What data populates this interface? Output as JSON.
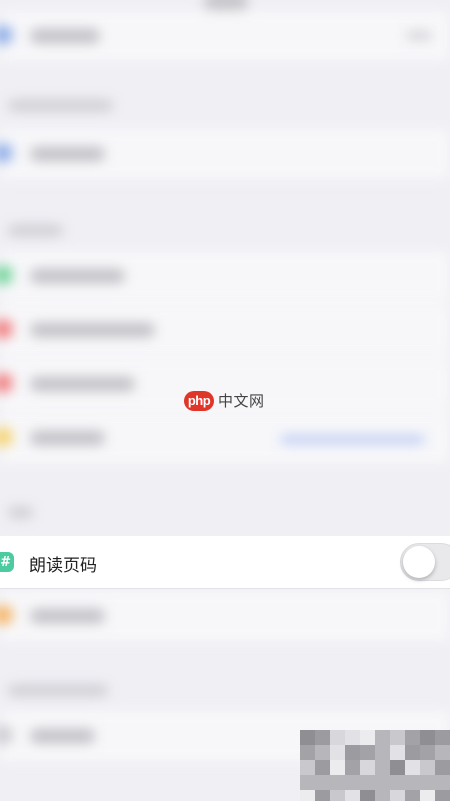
{
  "watermark": {
    "badge": "php",
    "text": "中文网"
  },
  "focused_setting": {
    "icon": "hash-icon",
    "label": "朗读页码",
    "toggle_on": false
  },
  "colors": {
    "accent_hash": "#4ccaa0",
    "watermark_red": "#e0362a"
  }
}
